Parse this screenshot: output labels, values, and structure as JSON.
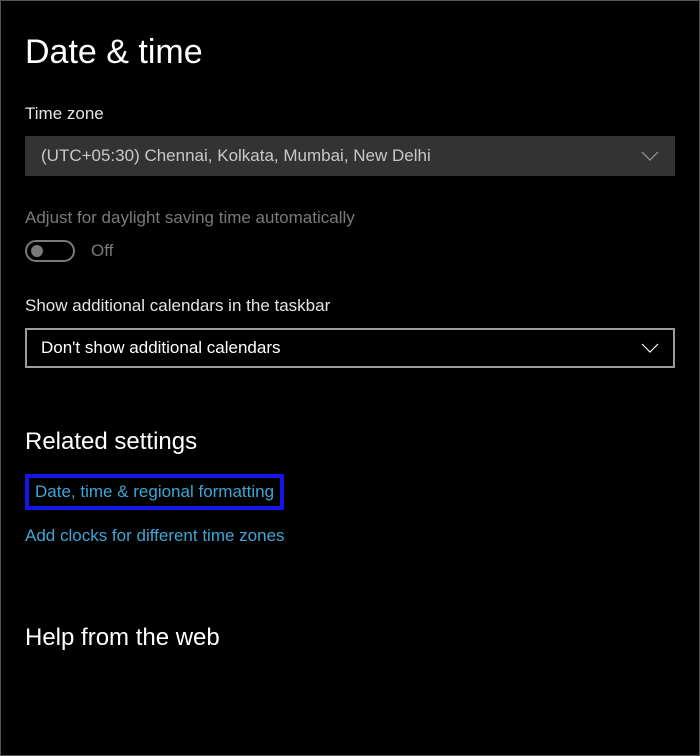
{
  "page": {
    "title": "Date & time"
  },
  "timezone": {
    "label": "Time zone",
    "selected": "(UTC+05:30) Chennai, Kolkata, Mumbai, New Delhi"
  },
  "dst": {
    "label": "Adjust for daylight saving time automatically",
    "state": "Off"
  },
  "calendars": {
    "label": "Show additional calendars in the taskbar",
    "selected": "Don't show additional calendars"
  },
  "related": {
    "heading": "Related settings",
    "link1": "Date, time & regional formatting",
    "link2": "Add clocks for different time zones"
  },
  "help": {
    "heading": "Help from the web"
  }
}
